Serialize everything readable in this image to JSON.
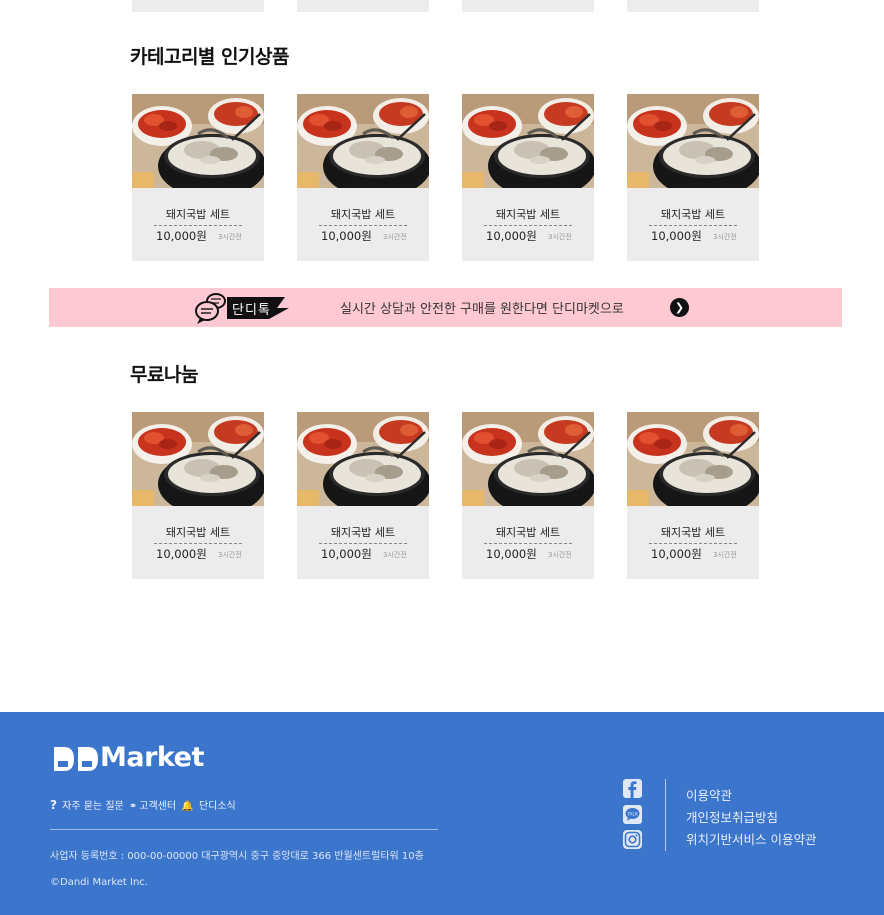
{
  "sections": [
    {
      "title": "카테고리별 인기상품",
      "products": [
        {
          "name": "돼지국밥 세트",
          "price": "10,000원",
          "time": "3시간전"
        },
        {
          "name": "돼지국밥 세트",
          "price": "10,000원",
          "time": "3시간전"
        },
        {
          "name": "돼지국밥 세트",
          "price": "10,000원",
          "time": "3시간전"
        },
        {
          "name": "돼지국밥 세트",
          "price": "10,000원",
          "time": "3시간전"
        }
      ]
    },
    {
      "title": "무료나눔",
      "products": [
        {
          "name": "돼지국밥 세트",
          "price": "10,000원",
          "time": "3시간전"
        },
        {
          "name": "돼지국밥 세트",
          "price": "10,000원",
          "time": "3시간전"
        },
        {
          "name": "돼지국밥 세트",
          "price": "10,000원",
          "time": "3시간전"
        },
        {
          "name": "돼지국밥 세트",
          "price": "10,000원",
          "time": "3시간전"
        }
      ]
    }
  ],
  "banner": {
    "talk_label": "단디톡",
    "text": "실시간 상담과 안전한 구매를 원한다면 단디마켓으로",
    "arrow_icon": "arrow-right-circle-icon",
    "background": "#ffc9d3"
  },
  "footer": {
    "logo": "DDMarket",
    "quick_links": [
      {
        "icon": "question-icon",
        "label": "자주 묻는 질문"
      },
      {
        "icon": "headset-icon",
        "label": "고객센터"
      },
      {
        "icon": "bell-icon",
        "label": "단디소식"
      }
    ],
    "address": "사업자 등록번호 : 000-00-00000 대구광역시 중구 중앙대로 366 반월센트럴타워 10층",
    "copyright": "©Dandi Market Inc.",
    "social": [
      "facebook-icon",
      "talk-icon",
      "instagram-icon"
    ],
    "policies": [
      "이용약관",
      "개인정보취급방침",
      "위치기반서비스 이용약관"
    ],
    "background": "#3c76cc"
  }
}
